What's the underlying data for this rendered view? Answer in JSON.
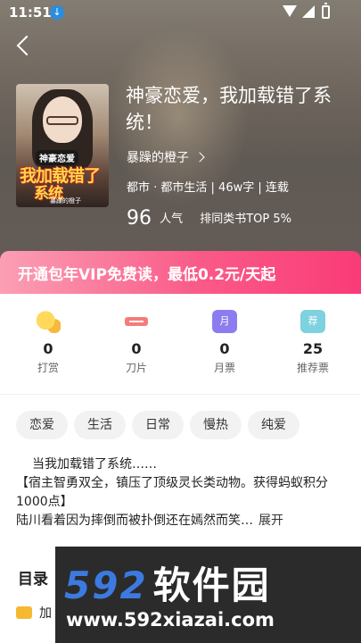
{
  "status": {
    "time": "11:51"
  },
  "cover": {
    "badge": "神豪恋爱",
    "title_line1": "我加载错了",
    "title_line2": "系统",
    "author_small": "暴躁的橙子"
  },
  "book": {
    "title": "神豪恋爱，我加载错了系统！",
    "author": "暴躁的橙子",
    "meta": "都市 · 都市生活 | 46w字 | 连载",
    "popularity": "96",
    "popularity_label": "人气",
    "rank": "排同类书TOP 5%"
  },
  "vip_banner": "开通包年VIP免费读，最低0.2元/天起",
  "stats": [
    {
      "icon": "coin-icon",
      "value": "0",
      "label": "打赏"
    },
    {
      "icon": "blade-icon",
      "value": "0",
      "label": "刀片"
    },
    {
      "icon": "month-ticket-icon",
      "glyph": "月",
      "value": "0",
      "label": "月票"
    },
    {
      "icon": "recommend-ticket-icon",
      "glyph": "荐",
      "value": "25",
      "label": "推荐票"
    }
  ],
  "tags": [
    "恋爱",
    "生活",
    "日常",
    "慢热",
    "纯爱"
  ],
  "description": {
    "line1": "当我加载错了系统……",
    "line2": "【宿主智勇双全，镇压了顶级灵长类动物。获得蚂蚁积分1000点】",
    "line3": "陆川看着因为摔倒而被扑倒还在嫣然而笑…",
    "expand": "展开"
  },
  "toc": {
    "title": "目录",
    "first_chapter": "加"
  },
  "watermark": {
    "digits": "592",
    "name": "软件园",
    "url": "www.592xiazai.com"
  },
  "colors": {
    "vip_gradient_start": "#fb9fb4",
    "vip_gradient_end": "#f93b77",
    "month_ticket": "#8b7df0",
    "recommend_ticket": "#7ed1de"
  }
}
